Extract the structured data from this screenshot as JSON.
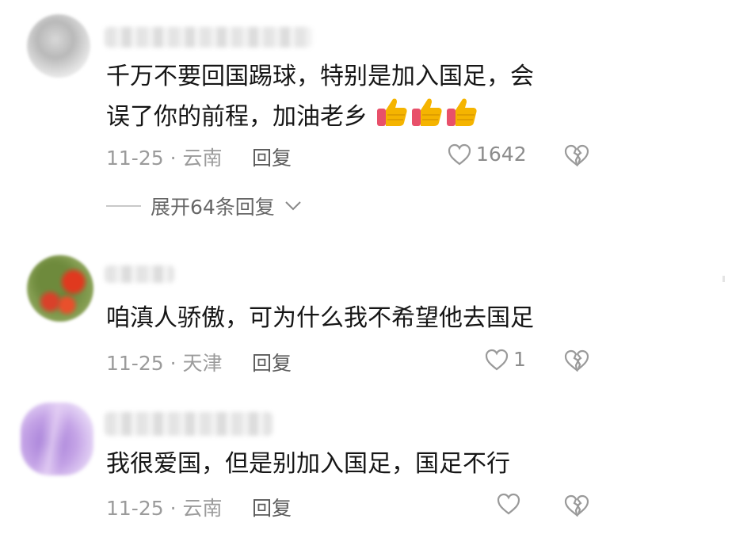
{
  "comments": [
    {
      "text_lines": [
        "千万不要回国踢球，特别是加入国足，会",
        "误了你的前程，加油老乡"
      ],
      "date": "11-25",
      "separator": "·",
      "location": "云南",
      "reply_label": "回复",
      "like_count": "1642",
      "emoji": [
        "thumbs-up",
        "thumbs-up",
        "thumbs-up"
      ]
    },
    {
      "text_lines": [
        "咱滇人骄傲，可为什么我不希望他去国足"
      ],
      "date": "11-25",
      "separator": "·",
      "location": "天津",
      "reply_label": "回复",
      "like_count": "1"
    },
    {
      "text_lines": [
        "我很爱国，但是别加入国足，国足不行"
      ],
      "date": "11-25",
      "separator": "·",
      "location": "云南",
      "reply_label": "回复",
      "like_count": ""
    }
  ],
  "expand_replies": {
    "label": "展开64条回复"
  },
  "colors": {
    "text": "#161616",
    "meta": "#9b9b9b",
    "emoji": "#f5b400",
    "emoji_cuff": "#e8506a"
  },
  "icons": [
    "heart-outline-icon",
    "broken-heart-icon",
    "chevron-down-icon",
    "thumbs-up-emoji"
  ]
}
